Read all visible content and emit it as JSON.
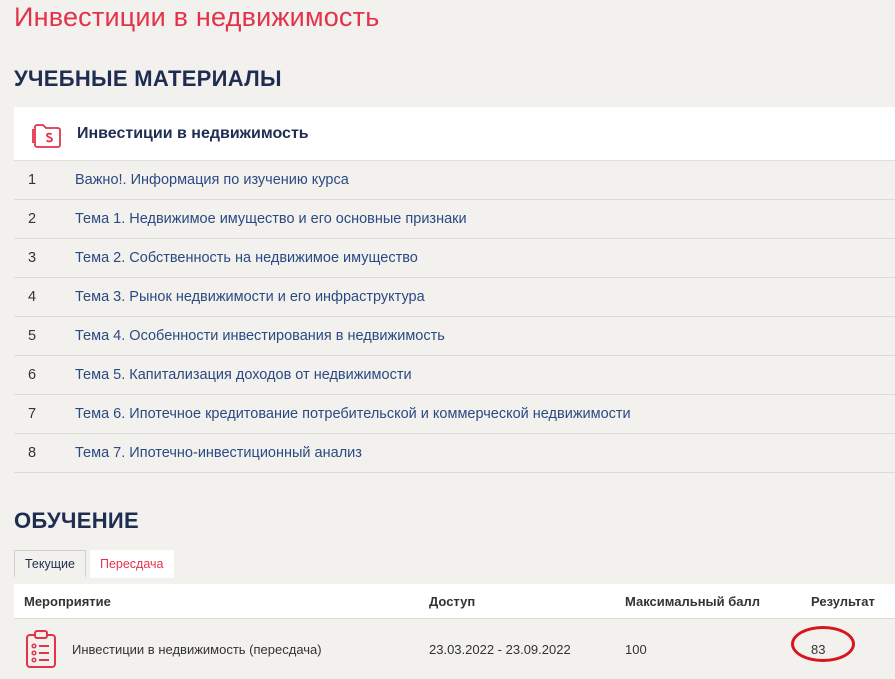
{
  "page_title": "Инвестиции в недвижимость",
  "materials": {
    "section_title": "УЧЕБНЫЕ МАТЕРИАЛЫ",
    "course_icon": "folder-s-icon",
    "course_name": "Инвестиции в недвижимость",
    "topics": [
      {
        "num": "1",
        "title": "Важно!. Информация по изучению курса"
      },
      {
        "num": "2",
        "title": "Тема 1. Недвижимое имущество и его основные признаки"
      },
      {
        "num": "3",
        "title": "Тема 2. Собственность на недвижимое имущество"
      },
      {
        "num": "4",
        "title": "Тема 3. Рынок недвижимости и его инфраструктура"
      },
      {
        "num": "5",
        "title": "Тема 4. Особенности инвестирования в недвижимость"
      },
      {
        "num": "6",
        "title": "Тема 5. Капитализация доходов от недвижимости"
      },
      {
        "num": "7",
        "title": "Тема 6. Ипотечное кредитование потребительской и коммерческой недвижимости"
      },
      {
        "num": "8",
        "title": "Тема 7. Ипотечно-инвестиционный анализ"
      }
    ]
  },
  "training": {
    "section_title": "ОБУЧЕНИЕ",
    "tabs": [
      {
        "label": "Текущие",
        "active": true
      },
      {
        "label": "Пересдача",
        "active": false
      }
    ],
    "columns": [
      "Мероприятие",
      "Доступ",
      "Максимальный балл",
      "Результат"
    ],
    "rows": [
      {
        "icon": "clipboard-checklist-icon",
        "event": "Инвестиции в недвижимость (пересдача)",
        "access": "23.03.2022 - 23.09.2022",
        "max_score": "100",
        "result": "83"
      }
    ]
  },
  "colors": {
    "accent_red": "#e3334b",
    "heading_navy": "#1f2d52",
    "link_blue": "#2b4a82",
    "annotation_red": "#d8141d",
    "background": "#f2f1ee"
  }
}
